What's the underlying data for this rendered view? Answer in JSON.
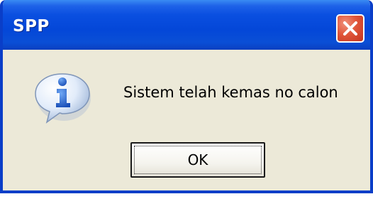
{
  "window": {
    "title": "SPP"
  },
  "dialog": {
    "icon": "information-icon",
    "message": "Sistem telah kemas no calon",
    "ok_label": "OK"
  },
  "colors": {
    "title_bar": "#0447d8",
    "dialog_background": "#ece9d8",
    "close_button": "#e0563a",
    "icon_blue": "#2a6fd6"
  }
}
